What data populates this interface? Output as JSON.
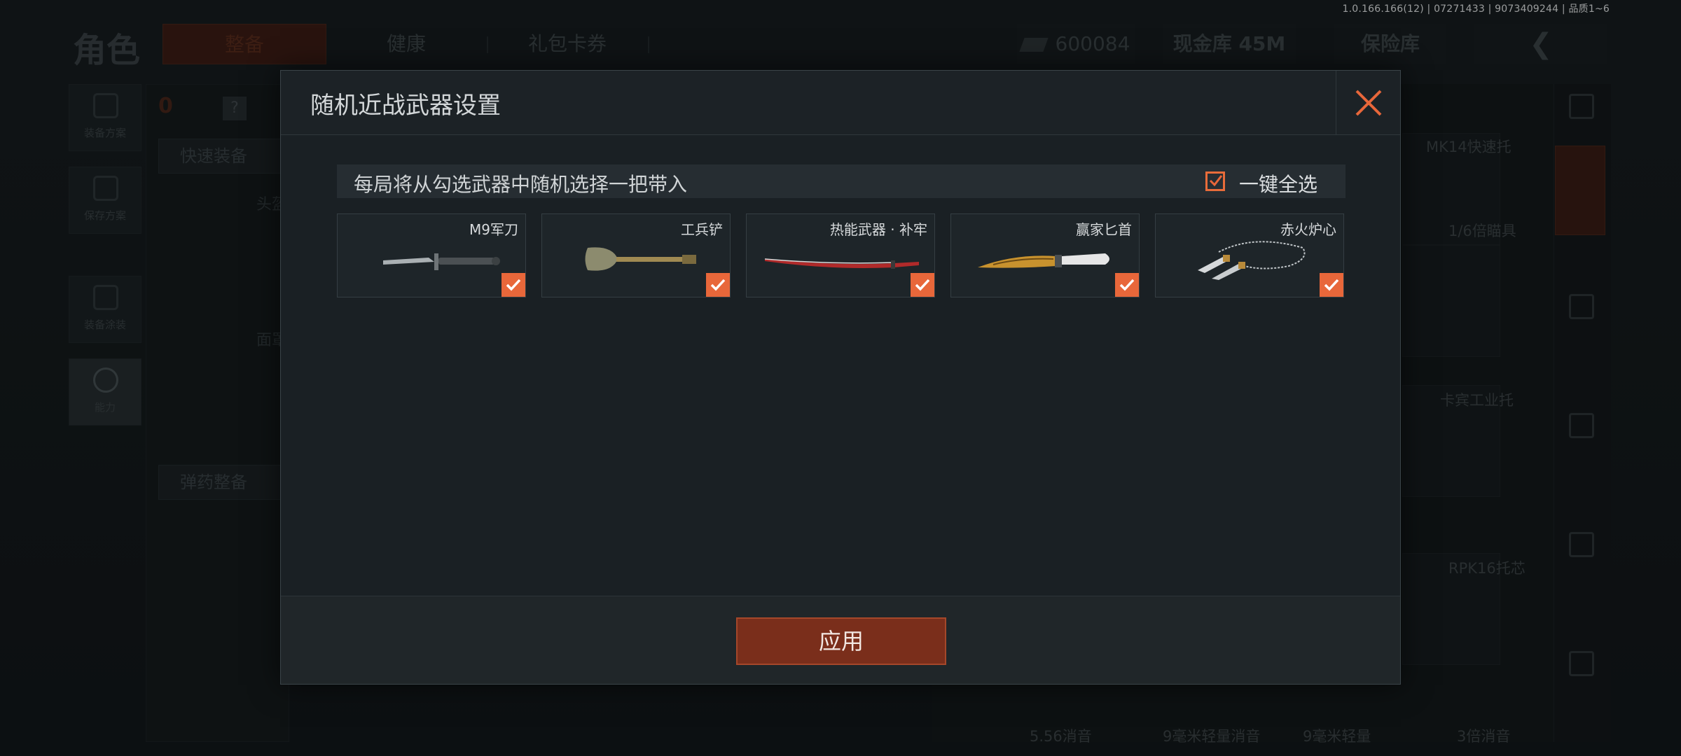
{
  "build_info": "1.0.166.166(12) | 07271433 | 9073409244 | 品质1~6",
  "background": {
    "page_title": "角色",
    "tabs": [
      "整备",
      "健康",
      "礼包卡券"
    ],
    "currency": {
      "money": "600084",
      "vault": "现金库 45M",
      "safe": "保险库"
    },
    "left_rail": [
      "装备方案",
      "保存方案",
      "装备涂装",
      "能力"
    ],
    "bag_count": "0",
    "help": "?",
    "panel_headers": [
      "快速装备",
      "弹药整备"
    ],
    "slot_labels": [
      "头盔",
      "面罩"
    ],
    "grid_labels": [
      "MK14快速托",
      "1/6倍瞄具",
      "卡宾工业托",
      "RPK16托芯",
      "5.56消音",
      "9毫米轻量消音",
      "9毫米轻量",
      "3倍消音"
    ]
  },
  "modal": {
    "title": "随机近战武器设置",
    "notice": "每局将从勾选武器中随机选择一把带入",
    "select_all": {
      "label": "一键全选",
      "checked": true
    },
    "weapons": [
      {
        "name": "M9军刀",
        "checked": true,
        "icon": "bayonet-knife-icon"
      },
      {
        "name": "工兵铲",
        "checked": true,
        "icon": "shovel-icon"
      },
      {
        "name": "热能武器 · 补牢",
        "checked": true,
        "icon": "katana-icon"
      },
      {
        "name": "赢家匕首",
        "checked": true,
        "icon": "dagger-icon"
      },
      {
        "name": "赤火炉心",
        "checked": true,
        "icon": "chain-blades-icon"
      }
    ],
    "apply_label": "应用"
  },
  "colors": {
    "accent": "#e8673a",
    "apply_button": "#7a2e1b",
    "modal_bg": "#1b2125"
  }
}
